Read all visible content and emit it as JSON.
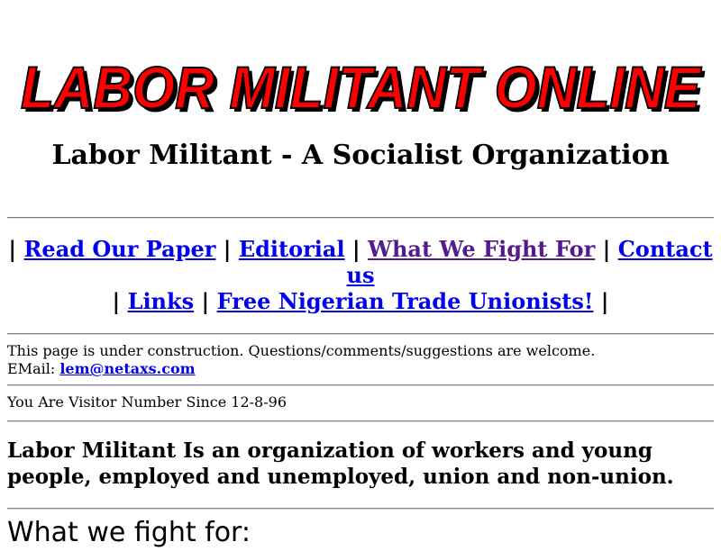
{
  "banner": {
    "text": "LABOR MILITANT ONLINE",
    "fill_color": "#ff0000",
    "shadow_color": "#000000"
  },
  "subtitle": "Labor Militant - A Socialist Organization",
  "nav": {
    "sep": "|",
    "links": [
      {
        "label": "Read Our Paper"
      },
      {
        "label": "Editorial"
      },
      {
        "label": "What We Fight For",
        "visited": true
      },
      {
        "label": "Contact us"
      },
      {
        "label": "Links"
      },
      {
        "label": "Free Nigerian Trade Unionists!"
      }
    ]
  },
  "notice": {
    "text": "This page is under construction. Questions/comments/suggestions are welcome.",
    "email_label": "EMail:",
    "email": "lem@netaxs.com"
  },
  "visitor": "You Are Visitor Number Since 12-8-96",
  "about": "Labor Militant Is an organization of workers and young people, employed and unemployed, union and non-union.",
  "fight_heading": "What we fight for:",
  "colors": {
    "link": "#0000ee",
    "visited_link": "#551a8b",
    "rule": "#808080"
  }
}
